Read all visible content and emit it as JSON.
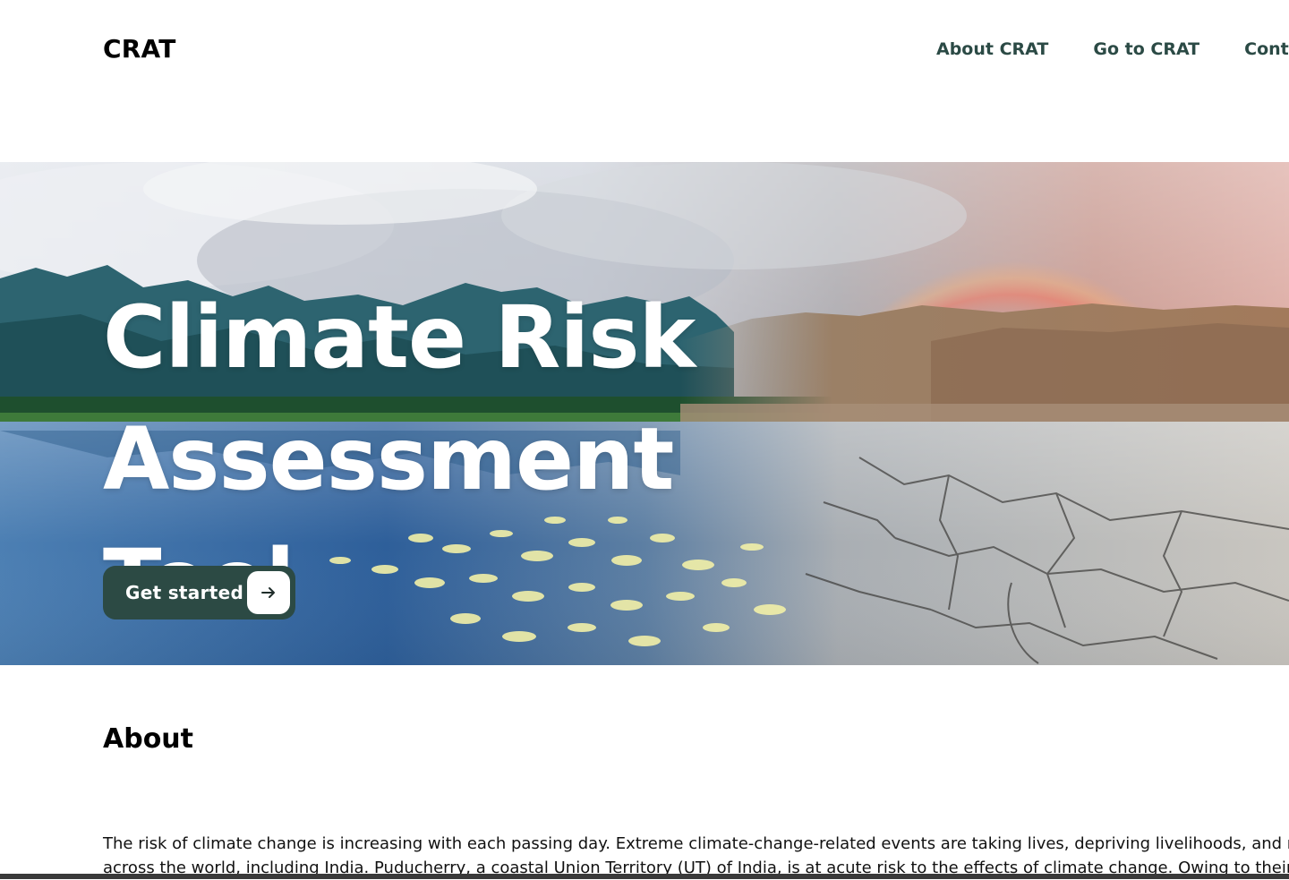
{
  "header": {
    "logo": "CRAT",
    "nav": [
      {
        "label": "About CRAT"
      },
      {
        "label": "Go to CRAT"
      },
      {
        "label": "Contact"
      }
    ]
  },
  "hero": {
    "title_line1": "Climate Risk",
    "title_line2": "Assessment Tool",
    "cta_label": "Get started",
    "cta_icon": "arrow-right-icon"
  },
  "about": {
    "heading": "About",
    "line1": "The risk of climate change is increasing with each passing day. Extreme climate-change-related events are taking lives, depriving livelihoods, and redu",
    "line2": "across the world, including India. Puducherry, a coastal Union Territory (UT) of India, is at acute risk to the effects of climate change. Owing to their"
  },
  "colors": {
    "brand_dark_green": "#2c4a44",
    "nav_text": "#2b4a45"
  }
}
